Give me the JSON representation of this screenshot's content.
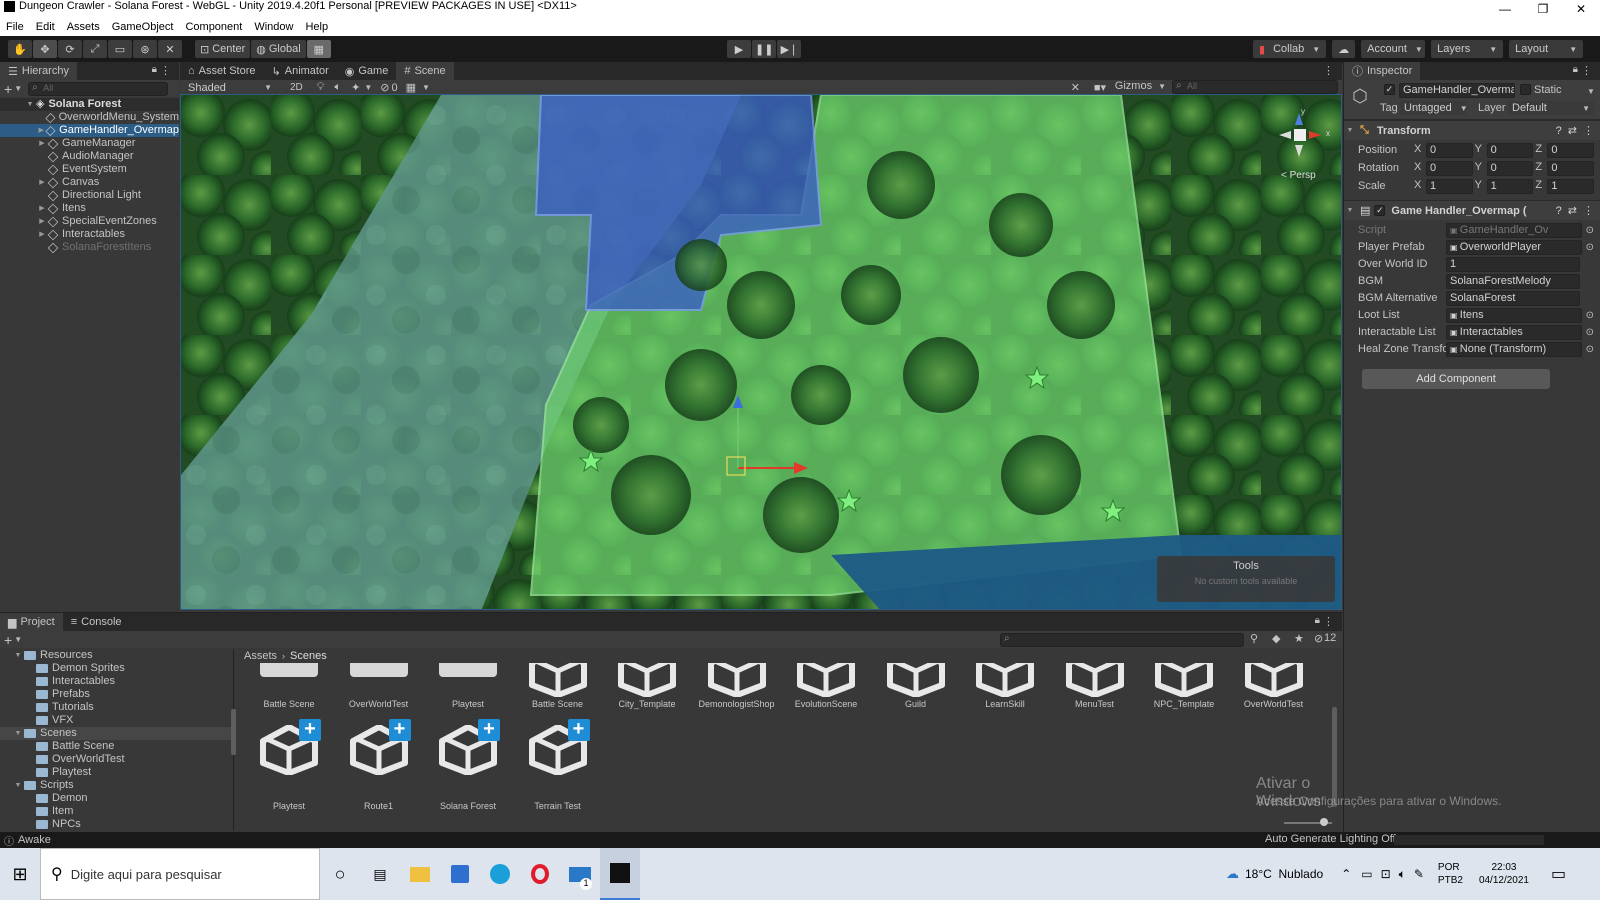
{
  "window": {
    "title": "Dungeon Crawler - Solana Forest - WebGL - Unity 2019.4.20f1 Personal [PREVIEW PACKAGES IN USE] <DX11>",
    "controls": [
      "—",
      "❐",
      "✕"
    ]
  },
  "menu": [
    "File",
    "Edit",
    "Assets",
    "GameObject",
    "Component",
    "Window",
    "Help"
  ],
  "toolbar": {
    "pivot": "Center",
    "space": "Global",
    "collab": "Collab",
    "account": "Account",
    "layers": "Layers",
    "layout": "Layout"
  },
  "hierarchy": {
    "tab": "Hierarchy",
    "search_placeholder": "All",
    "scene": "Solana Forest",
    "items": [
      {
        "label": "OverworldMenu_System",
        "expandable": false,
        "selected": false,
        "dim": false
      },
      {
        "label": "GameHandler_Overmap",
        "expandable": true,
        "selected": true,
        "dim": false
      },
      {
        "label": "GameManager",
        "expandable": true,
        "selected": false,
        "dim": false
      },
      {
        "label": "AudioManager",
        "expandable": false,
        "selected": false,
        "dim": false
      },
      {
        "label": "EventSystem",
        "expandable": false,
        "selected": false,
        "dim": false
      },
      {
        "label": "Canvas",
        "expandable": true,
        "selected": false,
        "dim": false
      },
      {
        "label": "Directional Light",
        "expandable": false,
        "selected": false,
        "dim": false
      },
      {
        "label": "Itens",
        "expandable": true,
        "selected": false,
        "dim": false
      },
      {
        "label": "SpecialEventZones",
        "expandable": true,
        "selected": false,
        "dim": false
      },
      {
        "label": "Interactables",
        "expandable": true,
        "selected": false,
        "dim": false
      },
      {
        "label": "SolanaForestItens",
        "expandable": false,
        "selected": false,
        "dim": true
      }
    ]
  },
  "scene_tabs": [
    "Asset Store",
    "Animator",
    "Game",
    "Scene"
  ],
  "scene_toolbar": {
    "shading": "Shaded",
    "mode2d": "2D",
    "hidden_count": "0",
    "gizmos": "Gizmos",
    "search_placeholder": "All"
  },
  "scene": {
    "persp_label": "< Persp",
    "tools_title": "Tools",
    "tools_sub": "No custom tools available"
  },
  "inspector": {
    "tab": "Inspector",
    "object_name": "GameHandler_Overma",
    "static_label": "Static",
    "tag_label": "Tag",
    "tag_value": "Untagged",
    "layer_label": "Layer",
    "layer_value": "Default",
    "transform": {
      "title": "Transform",
      "position_label": "Position",
      "rotation_label": "Rotation",
      "scale_label": "Scale",
      "position": [
        "0",
        "0",
        "0"
      ],
      "rotation": [
        "0",
        "0",
        "0"
      ],
      "scale": [
        "1",
        "1",
        "1"
      ]
    },
    "component": {
      "title": "Game Handler_Overmap (",
      "fields": [
        {
          "label": "Script",
          "value": "GameHandler_Ov",
          "ref": true,
          "dim": true
        },
        {
          "label": "Player Prefab",
          "value": "OverworldPlayer",
          "ref": true,
          "dim": false
        },
        {
          "label": "Over World ID",
          "value": "1",
          "ref": false,
          "dim": false
        },
        {
          "label": "BGM",
          "value": "SolanaForestMelody",
          "ref": false,
          "dim": false
        },
        {
          "label": "BGM Alternative",
          "value": "SolanaForest",
          "ref": false,
          "dim": false
        },
        {
          "label": "Loot List",
          "value": "Itens",
          "ref": true,
          "dim": false
        },
        {
          "label": "Interactable List",
          "value": "Interactables",
          "ref": true,
          "dim": false
        },
        {
          "label": "Heal Zone Transform",
          "value": "None (Transform)",
          "ref": true,
          "dim": false
        }
      ]
    },
    "add_component": "Add Component"
  },
  "project": {
    "tabs": [
      "Project",
      "Console"
    ],
    "hidden_count": "12",
    "breadcrumb": [
      "Assets",
      "Scenes"
    ],
    "tree": [
      {
        "label": "Resources",
        "depth": 1,
        "expanded": true
      },
      {
        "label": "Demon Sprites",
        "depth": 2,
        "expanded": false
      },
      {
        "label": "Interactables",
        "depth": 2,
        "expanded": false
      },
      {
        "label": "Prefabs",
        "depth": 2,
        "expanded": false
      },
      {
        "label": "Tutorials",
        "depth": 2,
        "expanded": false
      },
      {
        "label": "VFX",
        "depth": 2,
        "expanded": false
      },
      {
        "label": "Scenes",
        "depth": 1,
        "expanded": true
      },
      {
        "label": "Battle Scene",
        "depth": 2,
        "expanded": false
      },
      {
        "label": "OverWorldTest",
        "depth": 2,
        "expanded": false
      },
      {
        "label": "Playtest",
        "depth": 2,
        "expanded": false
      },
      {
        "label": "Scripts",
        "depth": 1,
        "expanded": true
      },
      {
        "label": "Demon",
        "depth": 2,
        "expanded": false
      },
      {
        "label": "Item",
        "depth": 2,
        "expanded": false
      },
      {
        "label": "NPCs",
        "depth": 2,
        "expanded": false
      }
    ],
    "assets_row1": [
      {
        "label": "Battle Scene",
        "kind": "folder"
      },
      {
        "label": "OverWorldTest",
        "kind": "folder"
      },
      {
        "label": "Playtest",
        "kind": "folder"
      },
      {
        "label": "Battle Scene",
        "kind": "unity"
      },
      {
        "label": "City_Template",
        "kind": "unity"
      },
      {
        "label": "DemonologistShop",
        "kind": "unity"
      },
      {
        "label": "EvolutionScene",
        "kind": "unity"
      },
      {
        "label": "Guild",
        "kind": "unity"
      },
      {
        "label": "LearnSkill",
        "kind": "unity"
      },
      {
        "label": "MenuTest",
        "kind": "unity"
      },
      {
        "label": "NPC_Template",
        "kind": "unity"
      },
      {
        "label": "OverWorldTest",
        "kind": "unity"
      }
    ],
    "assets_row2": [
      {
        "label": "Playtest"
      },
      {
        "label": "Route1"
      },
      {
        "label": "Solana Forest"
      },
      {
        "label": "Terrain Test"
      }
    ]
  },
  "watermark": {
    "line1": "Ativar o Windows",
    "line2": "Acesse Configurações para ativar o Windows."
  },
  "status": {
    "left": "Awake",
    "right": "Auto Generate Lighting Off"
  },
  "taskbar": {
    "search_placeholder": "Digite aqui para pesquisar",
    "weather": "18°C  Nublado",
    "lang1": "POR",
    "lang2": "PTB2",
    "time": "22:03",
    "date": "04/12/2021",
    "mail_badge": "1"
  }
}
